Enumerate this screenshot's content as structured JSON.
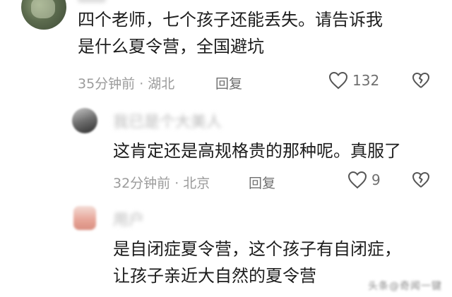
{
  "comments": [
    {
      "text_line1": "四个老师，七个孩子还能丢失。请告诉我",
      "text_line2": "是什么夏令营，全国避坑",
      "time": "35分钟前",
      "location": "湖北",
      "reply_label": "回复",
      "likes": "132"
    },
    {
      "username": "我已是个大美人",
      "text_line1": "这肯定还是高规格贵的那种呢。真服了",
      "time": "32分钟前",
      "location": "北京",
      "reply_label": "回复",
      "likes": "9"
    },
    {
      "username": "用户",
      "text_line1": "是自闭症夏令营，这个孩子有自闭症，",
      "text_line2": "让孩子亲近大自然的夏令营"
    }
  ],
  "watermark": "头条@奇闻一键",
  "icons": {
    "like": "heart-outline-icon",
    "dislike": "broken-heart-icon"
  }
}
